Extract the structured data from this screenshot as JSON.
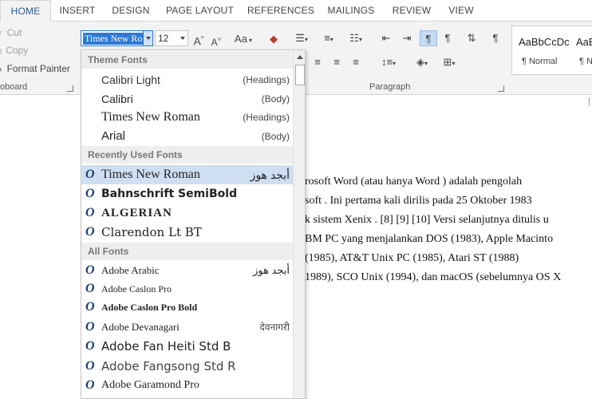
{
  "tabs": [
    "HOME",
    "INSERT",
    "DESIGN",
    "PAGE LAYOUT",
    "REFERENCES",
    "MAILINGS",
    "REVIEW",
    "VIEW"
  ],
  "clipboard": {
    "cut": "Cut",
    "copy": "Copy",
    "format_painter": "Format Painter",
    "group_label": "oboard"
  },
  "font": {
    "current_font": "Times New Ro",
    "size": "12",
    "grow": "A",
    "shrink": "A",
    "change_case": "Aa",
    "clear": "A"
  },
  "paragraph": {
    "group_label": "Paragraph"
  },
  "styles": [
    {
      "preview": "AaBbCcDc",
      "name": "¶ Normal"
    },
    {
      "preview": "AaB",
      "name": "¶ No"
    }
  ],
  "dropdown": {
    "theme_header": "Theme Fonts",
    "recent_header": "Recently Used Fonts",
    "all_header": "All Fonts",
    "theme_fonts": [
      {
        "name": "Calibri Light",
        "hint": "(Headings)"
      },
      {
        "name": "Calibri",
        "hint": "(Body)"
      },
      {
        "name": "Times New Roman",
        "hint": "(Headings)"
      },
      {
        "name": "Arial",
        "hint": "(Body)"
      }
    ],
    "recent_fonts": [
      {
        "name": "Times New Roman",
        "sample": "أبجد هوز",
        "glyph": "O"
      },
      {
        "name": "Bahnschrift SemiBold",
        "sample": "",
        "glyph": "O"
      },
      {
        "name": "ALGERIAN",
        "sample": "",
        "glyph": "O"
      },
      {
        "name": "Clarendon Lt BT",
        "sample": "",
        "glyph": "O"
      }
    ],
    "all_fonts": [
      {
        "name": "Adobe Arabic",
        "sample": "أبجد هوز",
        "glyph": "O"
      },
      {
        "name": "Adobe Caslon Pro",
        "sample": "",
        "glyph": "O"
      },
      {
        "name": "Adobe Caslon Pro Bold",
        "sample": "",
        "glyph": "O"
      },
      {
        "name": "Adobe Devanagari",
        "sample": "देवनागरी",
        "glyph": "O"
      },
      {
        "name": "Adobe Fan Heiti Std B",
        "sample": "",
        "glyph": "O"
      },
      {
        "name": "Adobe Fangsong Std R",
        "sample": "",
        "glyph": "O"
      },
      {
        "name": "Adobe Garamond Pro",
        "sample": "",
        "glyph": "O"
      }
    ]
  },
  "document": {
    "lines": [
      "rosoft    Word (atau    hanya Word )    adalah pengolah",
      "soft . Ini  pertama  kali  dirilis  pada  25  Oktober  1983",
      "k  sistem Xenix . [8] [9] [10] Versi  selanjutnya  ditulis  u",
      "BM  PC  yang menjalankan DOS (1983), Apple  Macinto",
      "(1985), AT&T    Unix    PC (1985), Atari    ST (1988)",
      "1989), SCO Unix (1994), dan macOS (sebelumnya OS X"
    ]
  },
  "colors": {
    "accent": "#2b579a",
    "selection": "#2b79d8",
    "highlight": "#cfdff2"
  }
}
